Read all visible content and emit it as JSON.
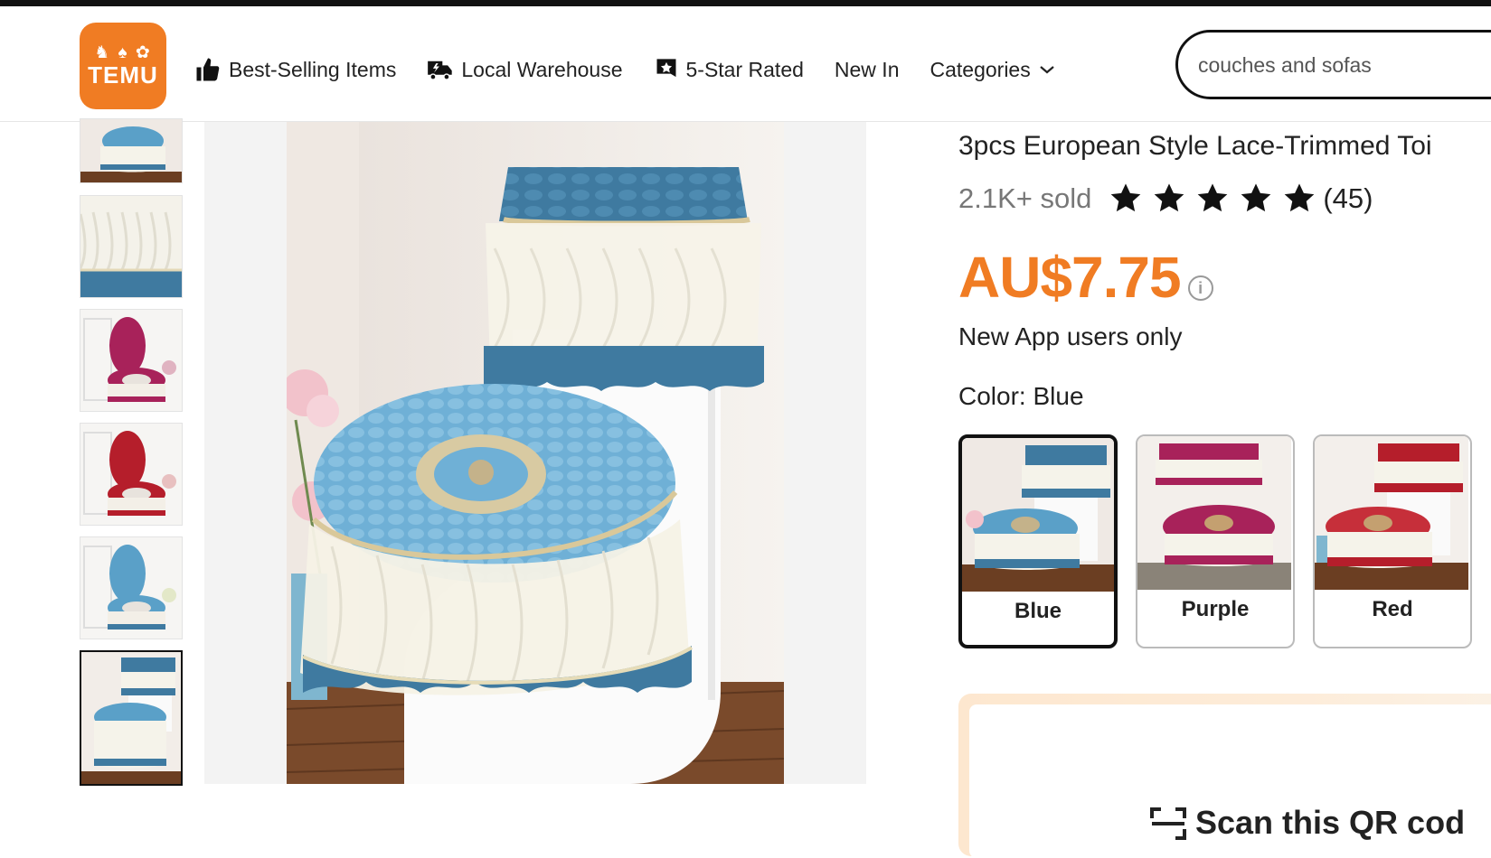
{
  "header": {
    "logo_glyphs": "♞ ♠ ✿",
    "logo_text": "TEMU",
    "nav": [
      {
        "label": "Best-Selling Items",
        "icon": "thumbs-up-icon"
      },
      {
        "label": "Local Warehouse",
        "icon": "delivery-truck-icon"
      },
      {
        "label": "5-Star Rated",
        "icon": "star-badge-icon"
      },
      {
        "label": "New In",
        "icon": ""
      },
      {
        "label": "Categories",
        "icon": "chevron-down-icon"
      }
    ],
    "search_value": "couches and sofas"
  },
  "gallery": {
    "thumbnails": [
      "blue",
      "lace-closeup",
      "purple",
      "red",
      "blue-open",
      "blue-selected"
    ],
    "selected_index": 5
  },
  "product": {
    "title": "3pcs European Style Lace-Trimmed Toi",
    "sold": "2.1K+ sold",
    "rating": 5,
    "reviews": "(45)",
    "price": "AU$7.75",
    "price_note": "New App users only",
    "color_label": "Color: Blue",
    "colors": [
      {
        "label": "Blue",
        "selected": true,
        "accent": "#3f7aa0"
      },
      {
        "label": "Purple",
        "selected": false,
        "accent": "#a8225a"
      },
      {
        "label": "Red",
        "selected": false,
        "accent": "#b51e2b"
      }
    ]
  },
  "qr": {
    "text": "Scan this QR cod"
  },
  "colors": {
    "brand": "#f07c23",
    "blue": "#3f7aa0",
    "light_blue": "#5aa0c8",
    "purple": "#a8225a",
    "red": "#b51e2b"
  }
}
